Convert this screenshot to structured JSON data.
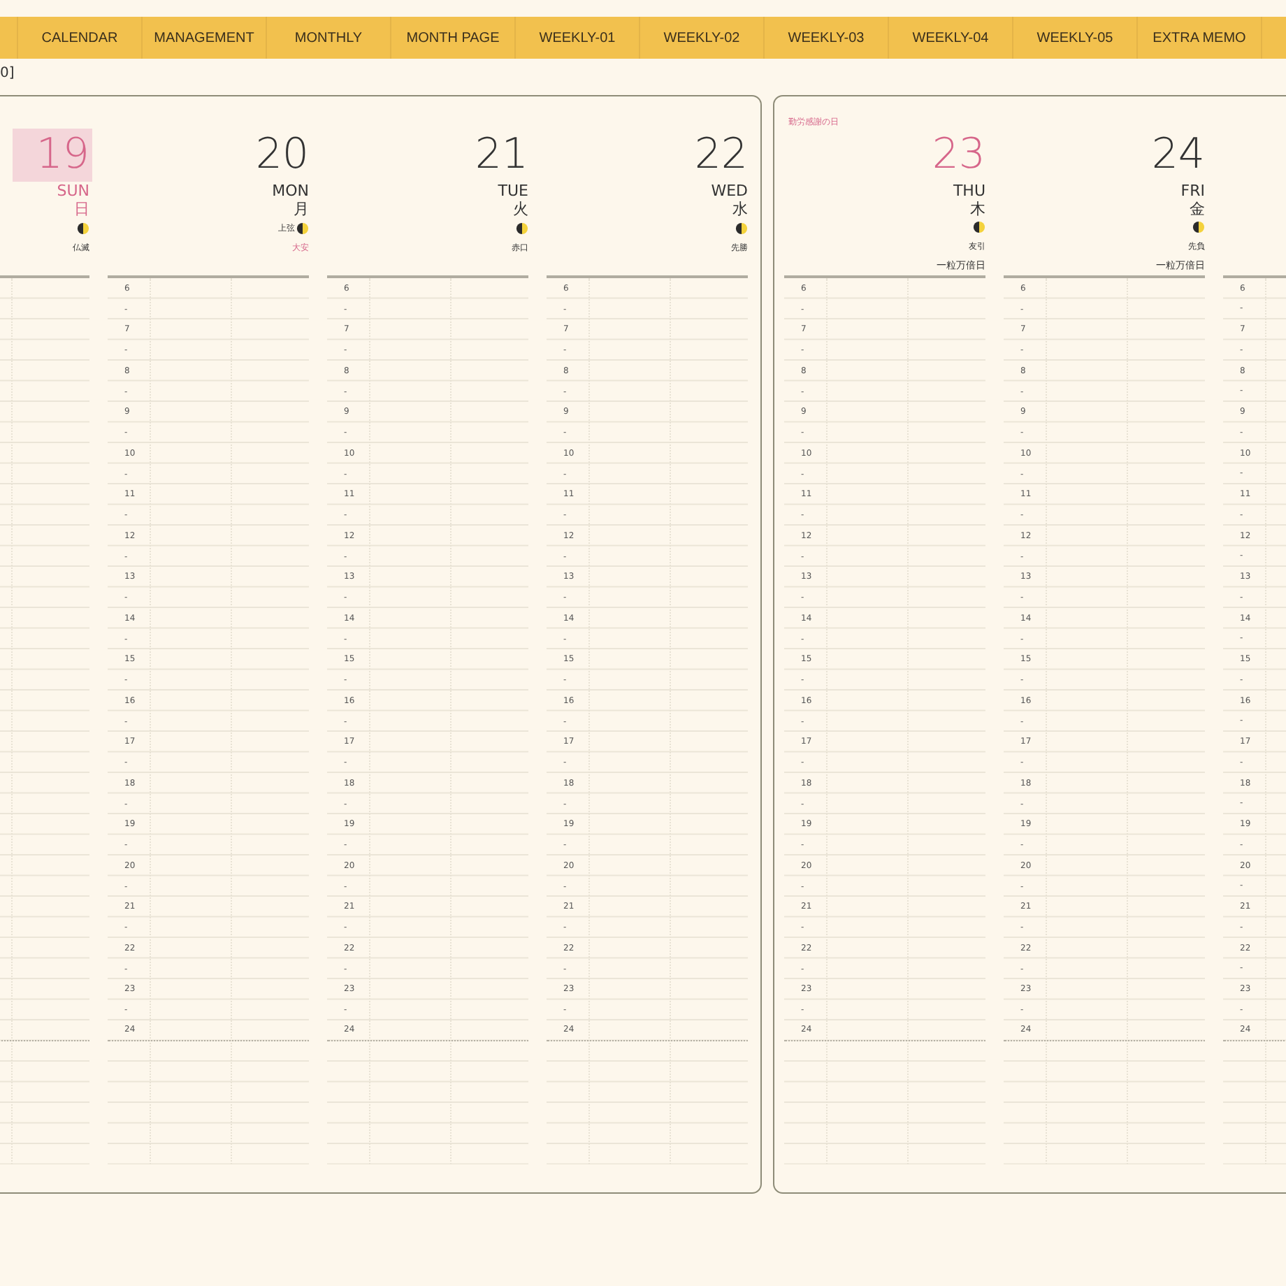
{
  "tabs": [
    {
      "label": "CALENDAR"
    },
    {
      "label": "MANAGEMENT"
    },
    {
      "label": "MONTHLY"
    },
    {
      "label": "MONTH PAGE"
    },
    {
      "label": "WEEKLY-01"
    },
    {
      "label": "WEEKLY-02"
    },
    {
      "label": "WEEKLY-03"
    },
    {
      "label": "WEEKLY-04"
    },
    {
      "label": "WEEKLY-05"
    },
    {
      "label": "EXTRA MEMO"
    }
  ],
  "page_note": "0]",
  "pages": [
    {
      "days": [
        {
          "kind": "sunday",
          "today": true,
          "date": "19",
          "weekday_en": "SUN",
          "weekday_ja": "日",
          "rokuyo": "仏滅",
          "rokuyo_lucky": false
        },
        {
          "kind": "weekday",
          "today": false,
          "date": "20",
          "weekday_en": "MON",
          "weekday_ja": "月",
          "moon_label": "上弦",
          "rokuyo": "大安",
          "rokuyo_lucky": true,
          "time_labels": [
            "6",
            "-",
            "7",
            "-",
            "8",
            "-",
            "9",
            "-",
            "10",
            "-",
            "11",
            "-",
            "12",
            "-",
            "13",
            "-",
            "14",
            "-",
            "15",
            "-",
            "16",
            "-",
            "17",
            "-",
            "18",
            "-",
            "19",
            "-",
            "20",
            "-",
            "21",
            "-",
            "22",
            "-",
            "23",
            "-",
            "24"
          ]
        },
        {
          "kind": "weekday",
          "today": false,
          "date": "21",
          "weekday_en": "TUE",
          "weekday_ja": "火",
          "rokuyo": "赤口",
          "rokuyo_lucky": false,
          "time_labels": [
            "6",
            "-",
            "7",
            "-",
            "8",
            "-",
            "9",
            "-",
            "10",
            "-",
            "11",
            "-",
            "12",
            "-",
            "13",
            "-",
            "14",
            "-",
            "15",
            "-",
            "16",
            "-",
            "17",
            "-",
            "18",
            "-",
            "19",
            "-",
            "20",
            "-",
            "21",
            "-",
            "22",
            "-",
            "23",
            "-",
            "24"
          ]
        },
        {
          "kind": "weekday",
          "today": false,
          "date": "22",
          "weekday_en": "WED",
          "weekday_ja": "水",
          "rokuyo": "先勝",
          "rokuyo_lucky": false,
          "time_labels": [
            "6",
            "-",
            "7",
            "-",
            "8",
            "-",
            "9",
            "-",
            "10",
            "-",
            "11",
            "-",
            "12",
            "-",
            "13",
            "-",
            "14",
            "-",
            "15",
            "-",
            "16",
            "-",
            "17",
            "-",
            "18",
            "-",
            "19",
            "-",
            "20",
            "-",
            "21",
            "-",
            "22",
            "-",
            "23",
            "-",
            "24"
          ]
        }
      ]
    },
    {
      "days": [
        {
          "kind": "holiday",
          "today": false,
          "date": "23",
          "weekday_en": "THU",
          "weekday_ja": "木",
          "rokuyo": "友引",
          "rokuyo_lucky": false,
          "note": "一粒万倍日",
          "holiday_name": "勤労感謝の日",
          "time_labels": [
            "6",
            "-",
            "7",
            "-",
            "8",
            "-",
            "9",
            "-",
            "10",
            "-",
            "11",
            "-",
            "12",
            "-",
            "13",
            "-",
            "14",
            "-",
            "15",
            "-",
            "16",
            "-",
            "17",
            "-",
            "18",
            "-",
            "19",
            "-",
            "20",
            "-",
            "21",
            "-",
            "22",
            "-",
            "23",
            "-",
            "24"
          ]
        },
        {
          "kind": "weekday",
          "today": false,
          "date": "24",
          "weekday_en": "FRI",
          "weekday_ja": "金",
          "rokuyo": "先負",
          "rokuyo_lucky": false,
          "note": "一粒万倍日",
          "time_labels": [
            "6",
            "-",
            "7",
            "-",
            "8",
            "-",
            "9",
            "-",
            "10",
            "-",
            "11",
            "-",
            "12",
            "-",
            "13",
            "-",
            "14",
            "-",
            "15",
            "-",
            "16",
            "-",
            "17",
            "-",
            "18",
            "-",
            "19",
            "-",
            "20",
            "-",
            "21",
            "-",
            "22",
            "-",
            "23",
            "-",
            "24"
          ]
        },
        {
          "kind": "hidden",
          "time_labels": [
            "6",
            "-",
            "7",
            "-",
            "8",
            "-",
            "9",
            "-",
            "10",
            "-",
            "11",
            "-",
            "12",
            "-",
            "13",
            "-",
            "14",
            "-",
            "15",
            "-",
            "16",
            "-",
            "17",
            "-",
            "18",
            "-",
            "19",
            "-",
            "20",
            "-",
            "21",
            "-",
            "22",
            "-",
            "23",
            "-",
            "24"
          ]
        }
      ]
    }
  ]
}
